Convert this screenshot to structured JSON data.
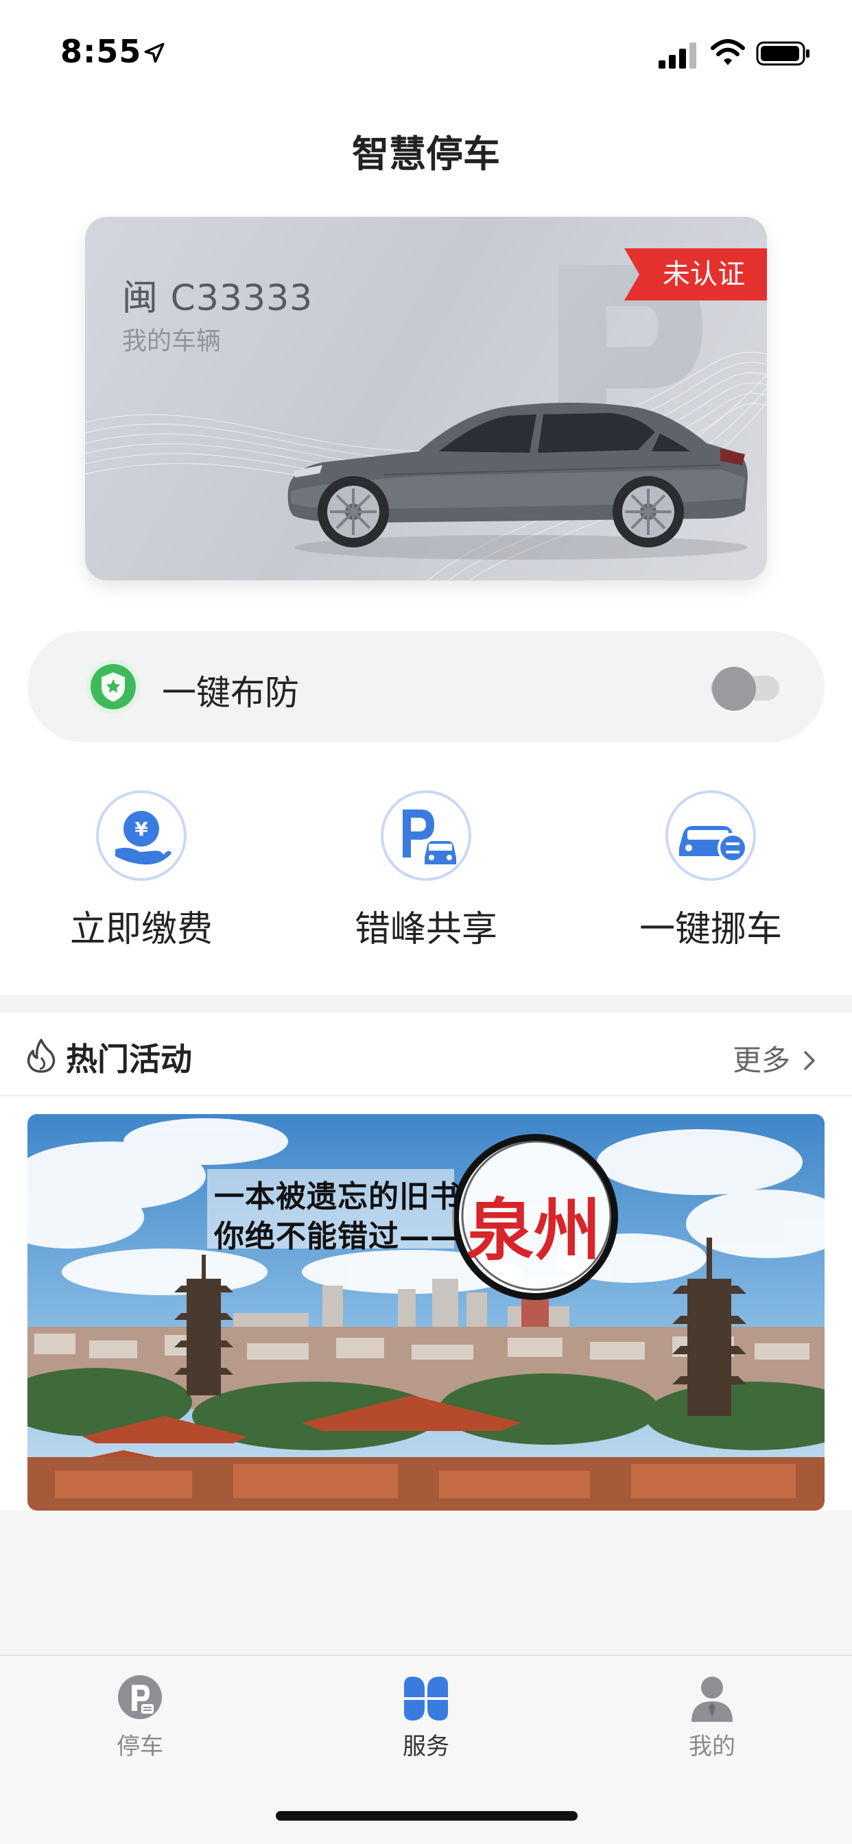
{
  "status_bar": {
    "time": "8:55"
  },
  "nav": {
    "title": "智慧停车"
  },
  "vehicle_card": {
    "plate": "闽 C33333",
    "subtitle": "我的车辆",
    "badge": "未认证"
  },
  "defense": {
    "label": "一键布防",
    "enabled": false
  },
  "quick_actions": [
    {
      "label": "立即缴费",
      "icon": "yuan-hand-icon"
    },
    {
      "label": "错峰共享",
      "icon": "parking-car-icon"
    },
    {
      "label": "一键挪车",
      "icon": "car-move-icon"
    }
  ],
  "hot_section": {
    "title": "热门活动",
    "more": "更多"
  },
  "banner": {
    "line1": "一本被遗忘的旧书",
    "line2": "你绝不能错过——",
    "city": "泉州"
  },
  "tabs": [
    {
      "label": "停车",
      "active": false
    },
    {
      "label": "服务",
      "active": true
    },
    {
      "label": "我的",
      "active": false
    }
  ],
  "colors": {
    "accent_blue": "#3a7be0",
    "badge_red": "#e5312e",
    "shield_green": "#3dbb5a"
  }
}
